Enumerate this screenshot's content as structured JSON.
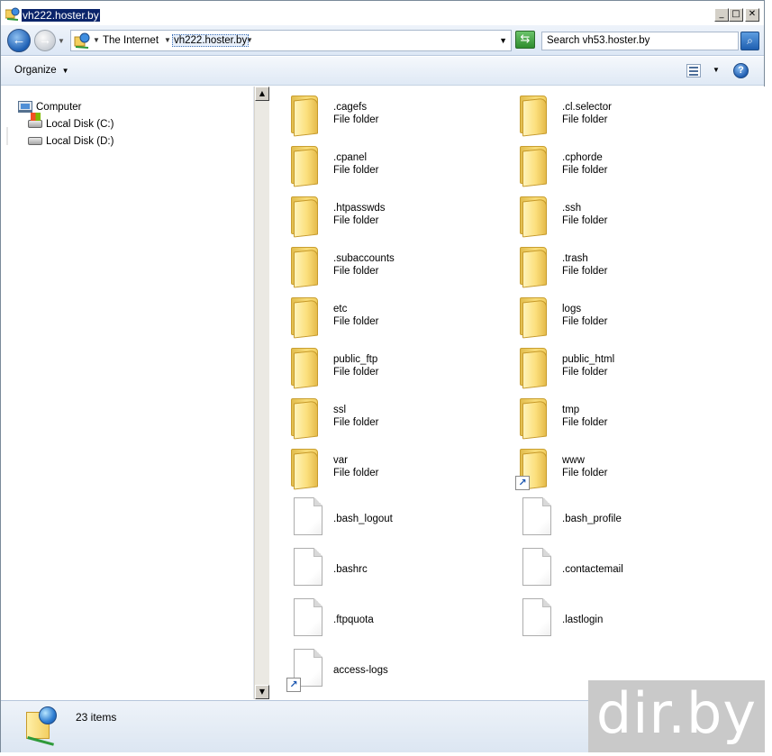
{
  "window": {
    "title": "vh222.hoster.by",
    "controls": {
      "minimize": "_",
      "maximize": "□",
      "close": "✕"
    }
  },
  "address_bar": {
    "breadcrumbs": [
      "The Internet",
      "vh222.hoster.by"
    ],
    "search_placeholder": "Search vh53.hoster.by"
  },
  "command_bar": {
    "organize_label": "Organize"
  },
  "nav_pane": {
    "root": "Computer",
    "items": [
      "Local Disk (C:)",
      "Local Disk (D:)"
    ]
  },
  "files": [
    {
      "name": ".cagefs",
      "type": "File folder",
      "kind": "folder"
    },
    {
      "name": ".cl.selector",
      "type": "File folder",
      "kind": "folder"
    },
    {
      "name": ".cpanel",
      "type": "File folder",
      "kind": "folder"
    },
    {
      "name": ".cphorde",
      "type": "File folder",
      "kind": "folder"
    },
    {
      "name": ".htpasswds",
      "type": "File folder",
      "kind": "folder"
    },
    {
      "name": ".ssh",
      "type": "File folder",
      "kind": "folder"
    },
    {
      "name": ".subaccounts",
      "type": "File folder",
      "kind": "folder"
    },
    {
      "name": ".trash",
      "type": "File folder",
      "kind": "folder"
    },
    {
      "name": "etc",
      "type": "File folder",
      "kind": "folder"
    },
    {
      "name": "logs",
      "type": "File folder",
      "kind": "folder"
    },
    {
      "name": "public_ftp",
      "type": "File folder",
      "kind": "folder"
    },
    {
      "name": "public_html",
      "type": "File folder",
      "kind": "folder"
    },
    {
      "name": "ssl",
      "type": "File folder",
      "kind": "folder"
    },
    {
      "name": "tmp",
      "type": "File folder",
      "kind": "folder"
    },
    {
      "name": "var",
      "type": "File folder",
      "kind": "folder"
    },
    {
      "name": "www",
      "type": "File folder",
      "kind": "folder",
      "shortcut": true
    },
    {
      "name": ".bash_logout",
      "kind": "file"
    },
    {
      "name": ".bash_profile",
      "kind": "file"
    },
    {
      "name": ".bashrc",
      "kind": "file"
    },
    {
      "name": ".contactemail",
      "kind": "file"
    },
    {
      "name": ".ftpquota",
      "kind": "file"
    },
    {
      "name": ".lastlogin",
      "kind": "file"
    },
    {
      "name": "access-logs",
      "kind": "file",
      "shortcut": true
    }
  ],
  "status": {
    "item_count": "23 items"
  },
  "watermark": "dir.by"
}
